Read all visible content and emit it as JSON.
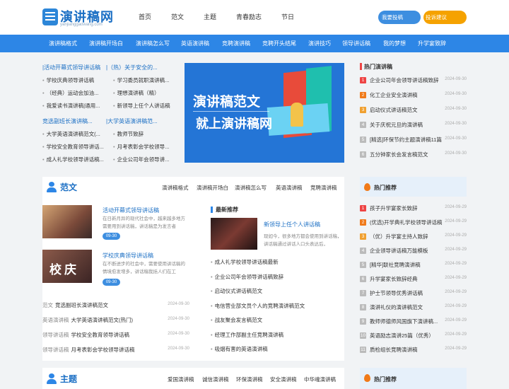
{
  "header": {
    "logo_title": "演讲稿网",
    "logo_sub": "yanjianggaowang.com",
    "nav": [
      "首页",
      "范文",
      "主题",
      "青春励志",
      "节日"
    ],
    "submit_label": "我要投稿",
    "suggest_label": "投诉建议"
  },
  "catbar": [
    "演讲稿格式",
    "演讲稿开场白",
    "演讲稿怎么写",
    "英语演讲稿",
    "竞聘演讲稿",
    "竞聘开头结尾",
    "演讲技巧",
    "领导讲话稿",
    "我的梦想",
    "升学宴致辞"
  ],
  "top_lists": {
    "col1_head": "|活动开幕式领导讲话稿",
    "col2_head": "|（热）关于安全的...",
    "col1_items": [
      "学校庆典领导讲话稿",
      "（经典）运动会加油...",
      "我爱读书演讲稿|通用..."
    ],
    "col2_items": [
      "学习委员就职演讲稿...",
      "理想演讲稿（精）",
      "新领导上任个人讲话稿"
    ],
    "col3_head": "竞选副班长演讲稿...",
    "col4_head": "|大学英语演讲稿范...",
    "col3_items": [
      "大学英语演讲稿范文(...",
      "学校安全教育领导讲话...",
      "成人礼学校领导讲话稿..."
    ],
    "col4_items": [
      "教师节致辞",
      "月考表彰会学校领导...",
      "企业公司年会领导讲..."
    ]
  },
  "banner": {
    "line1": "演讲稿范文",
    "line2": "就上演讲稿网"
  },
  "hot_speech": {
    "title": "热门演讲稿",
    "items": [
      {
        "n": "1",
        "t": "企业公司年会领导讲话稿致辞",
        "d": "2024-09-30"
      },
      {
        "n": "2",
        "t": "化工企业安全演讲稿",
        "d": "2024-09-30"
      },
      {
        "n": "3",
        "t": "启动仪式讲话稿范文",
        "d": "2024-09-30"
      },
      {
        "n": "4",
        "t": "关于庆祝元旦的演讲稿",
        "d": "2024-09-30"
      },
      {
        "n": "5",
        "t": "[精选]环保节约主题演讲稿11篇",
        "d": "2024-09-30"
      },
      {
        "n": "6",
        "t": "五分钟家长会发言稿范文",
        "d": "2024-09-30"
      }
    ]
  },
  "fanwen": {
    "title": "范文",
    "tabs": [
      "演讲稿格式",
      "演讲稿开场白",
      "演讲稿怎么写",
      "英语演讲稿",
      "竞聘演讲稿"
    ],
    "articles": [
      {
        "title": "活动开幕式领导讲话稿",
        "desc": "在日新月异的现代社会中，越来越多地方需要用到讲话稿，讲话稿是为发言者",
        "tag": "09-30"
      },
      {
        "title": "学校庆典领导讲话稿",
        "desc": "在不断进步的社会中，需要使用讲话稿的情境愈发增多，讲话稿我括人们在工",
        "tag": "09-30",
        "thumb_text": "校庆"
      }
    ],
    "rows": [
      {
        "cat": "范文",
        "t": "竞选副班长演讲稿范文",
        "d": "2024-09-30"
      },
      {
        "cat": "英语演讲稿",
        "t": "大学英语演讲稿范文(热门)",
        "d": "2024-09-30"
      },
      {
        "cat": "领导讲话稿",
        "t": "学校安全教育领导讲话稿",
        "d": "2024-09-30"
      },
      {
        "cat": "领导讲话稿",
        "t": "月考表彰会学校领导讲话稿",
        "d": "2024-09-30"
      }
    ],
    "recommend_title": "最新推荐",
    "recommend": {
      "title": "新领导上任个人讲话稿",
      "desc": "现如今，很多地方都会使用到讲话稿，讲话稿通过讲话人口头表达后，"
    },
    "recommend_list": [
      "成人礼学校领导讲话稿最新",
      "企业公司年会领导讲话稿致辞",
      "启动仪式讲话稿范文",
      "电信营业部文员个人的竞聘演讲稿范文",
      "战友聚会发言稿范文",
      "经理工作部副主任竞聘演讲稿",
      "吸烟有害的英语演讲稿"
    ]
  },
  "hot_recommend": {
    "title": "热门推荐",
    "items": [
      {
        "n": "1",
        "t": "孩子升学宴家长致辞",
        "d": "2024-09-29"
      },
      {
        "n": "2",
        "t": "(优选)开学典礼学校领导讲话稿",
        "d": "2024-09-29"
      },
      {
        "n": "3",
        "t": "（优）升学宴主持人致辞",
        "d": "2024-09-29"
      },
      {
        "n": "4",
        "t": "企业领导讲话稿万能模板",
        "d": "2024-09-29"
      },
      {
        "n": "5",
        "t": "[精华]联社竞聘演讲稿",
        "d": "2024-09-29"
      },
      {
        "n": "6",
        "t": "升学宴家长致辞经典",
        "d": "2024-09-29"
      },
      {
        "n": "7",
        "t": "护士节领导优秀讲话稿",
        "d": "2024-09-29"
      },
      {
        "n": "8",
        "t": "演讲礼仪的演讲稿范文",
        "d": "2024-09-29"
      },
      {
        "n": "9",
        "t": "教师师德师风国旗下演讲稿...",
        "d": "2024-09-29"
      },
      {
        "n": "10",
        "t": "英语励志演讲25篇（优秀）",
        "d": "2024-09-29"
      },
      {
        "n": "11",
        "t": "质检组长竞聘演讲稿",
        "d": "2024-09-29"
      }
    ]
  },
  "zhuti": {
    "title": "主题",
    "tabs": [
      "爱国演讲稿",
      "诚信演讲稿",
      "环保演讲稿",
      "安全演讲稿",
      "中华魂演讲稿"
    ]
  },
  "hot_recommend2": {
    "title": "热门推荐"
  },
  "colors": {
    "brand": "#1b6fc4",
    "catbar": "#2d86e6",
    "orange": "#f5a200",
    "red": "#e44"
  }
}
